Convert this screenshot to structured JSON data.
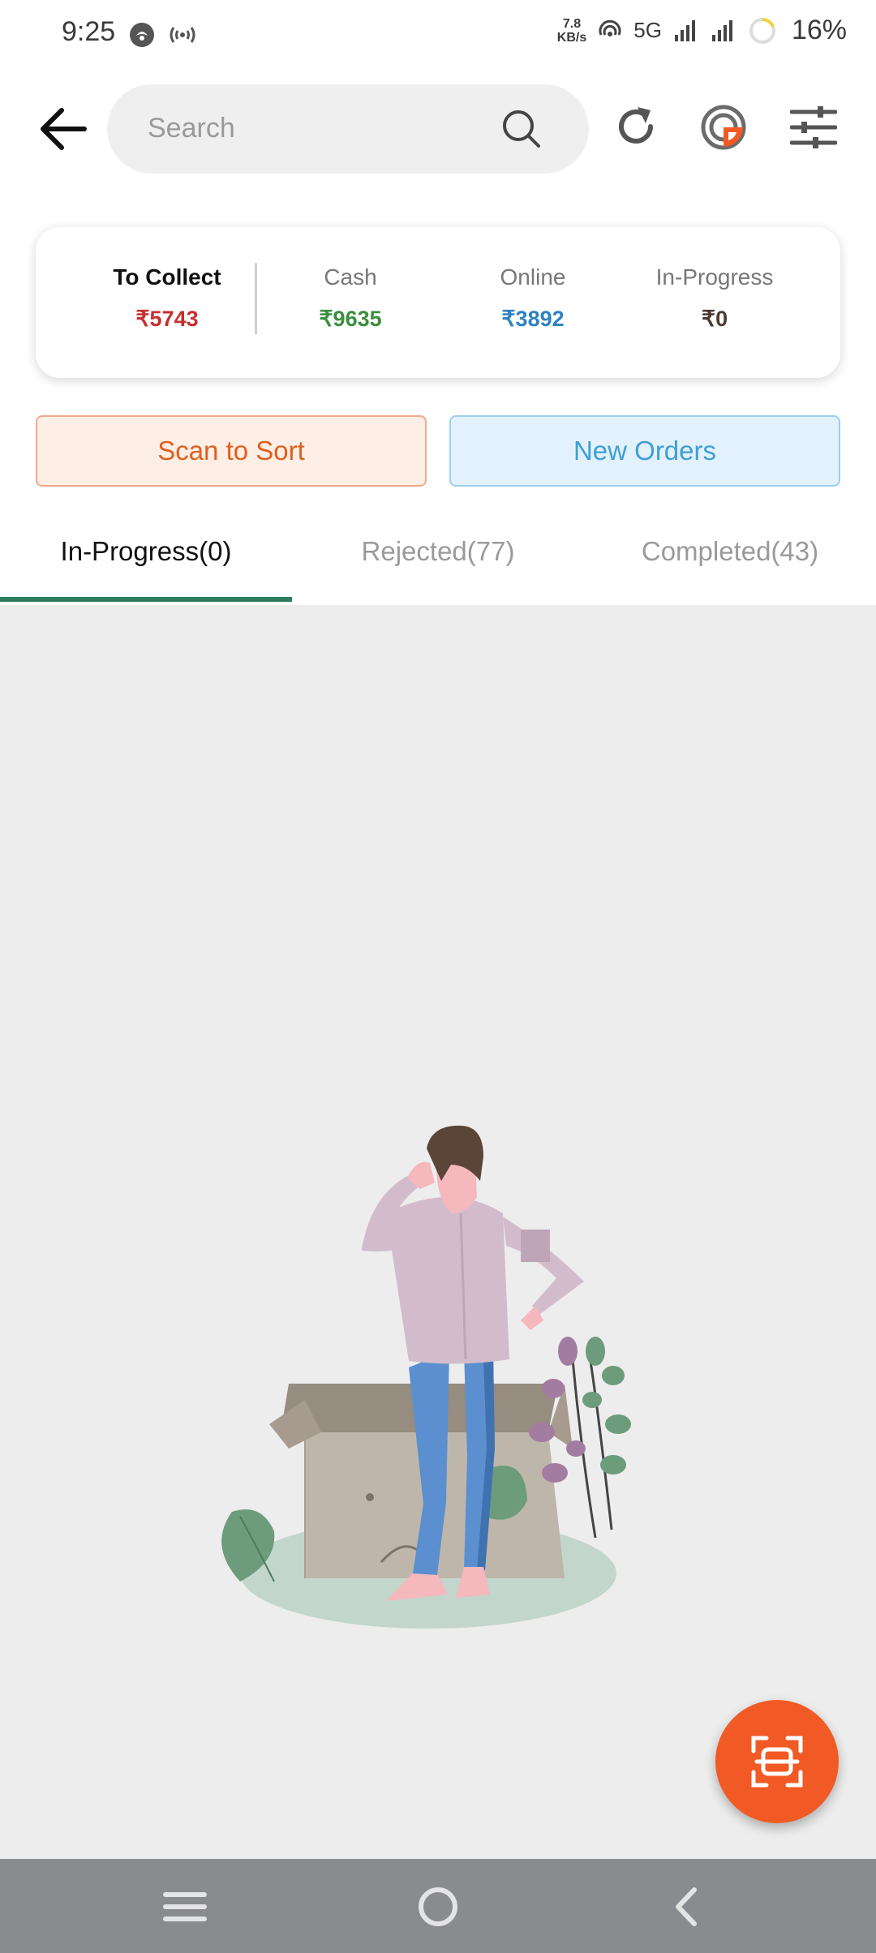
{
  "status_bar": {
    "time": "9:25",
    "speed_value": "7.8",
    "speed_unit": "KB/s",
    "network": "5G",
    "battery": "16%"
  },
  "search": {
    "placeholder": "Search"
  },
  "summary": {
    "to_collect_label": "To Collect",
    "to_collect_value": "₹5743",
    "cash_label": "Cash",
    "cash_value": "₹9635",
    "online_label": "Online",
    "online_value": "₹3892",
    "in_progress_label": "In-Progress",
    "in_progress_value": "₹0"
  },
  "actions": {
    "scan_to_sort": "Scan to Sort",
    "new_orders": "New Orders"
  },
  "tabs": [
    {
      "label": "In-Progress(0)",
      "active": true
    },
    {
      "label": "Rejected(77)",
      "active": false
    },
    {
      "label": "Completed(43)",
      "active": false
    }
  ],
  "colors": {
    "to_collect": "#c62f2f",
    "cash": "#3b8f3f",
    "online": "#2f82c0",
    "in_progress": "#4a3a32",
    "accent_orange": "#f15a24",
    "tab_indicator": "#2e7d5e"
  },
  "icons": {
    "back": "back-arrow-icon",
    "search": "search-icon",
    "refresh": "refresh-icon",
    "brand": "brand-logo-icon",
    "filter": "filter-sliders-icon",
    "fab": "scan-icon"
  }
}
